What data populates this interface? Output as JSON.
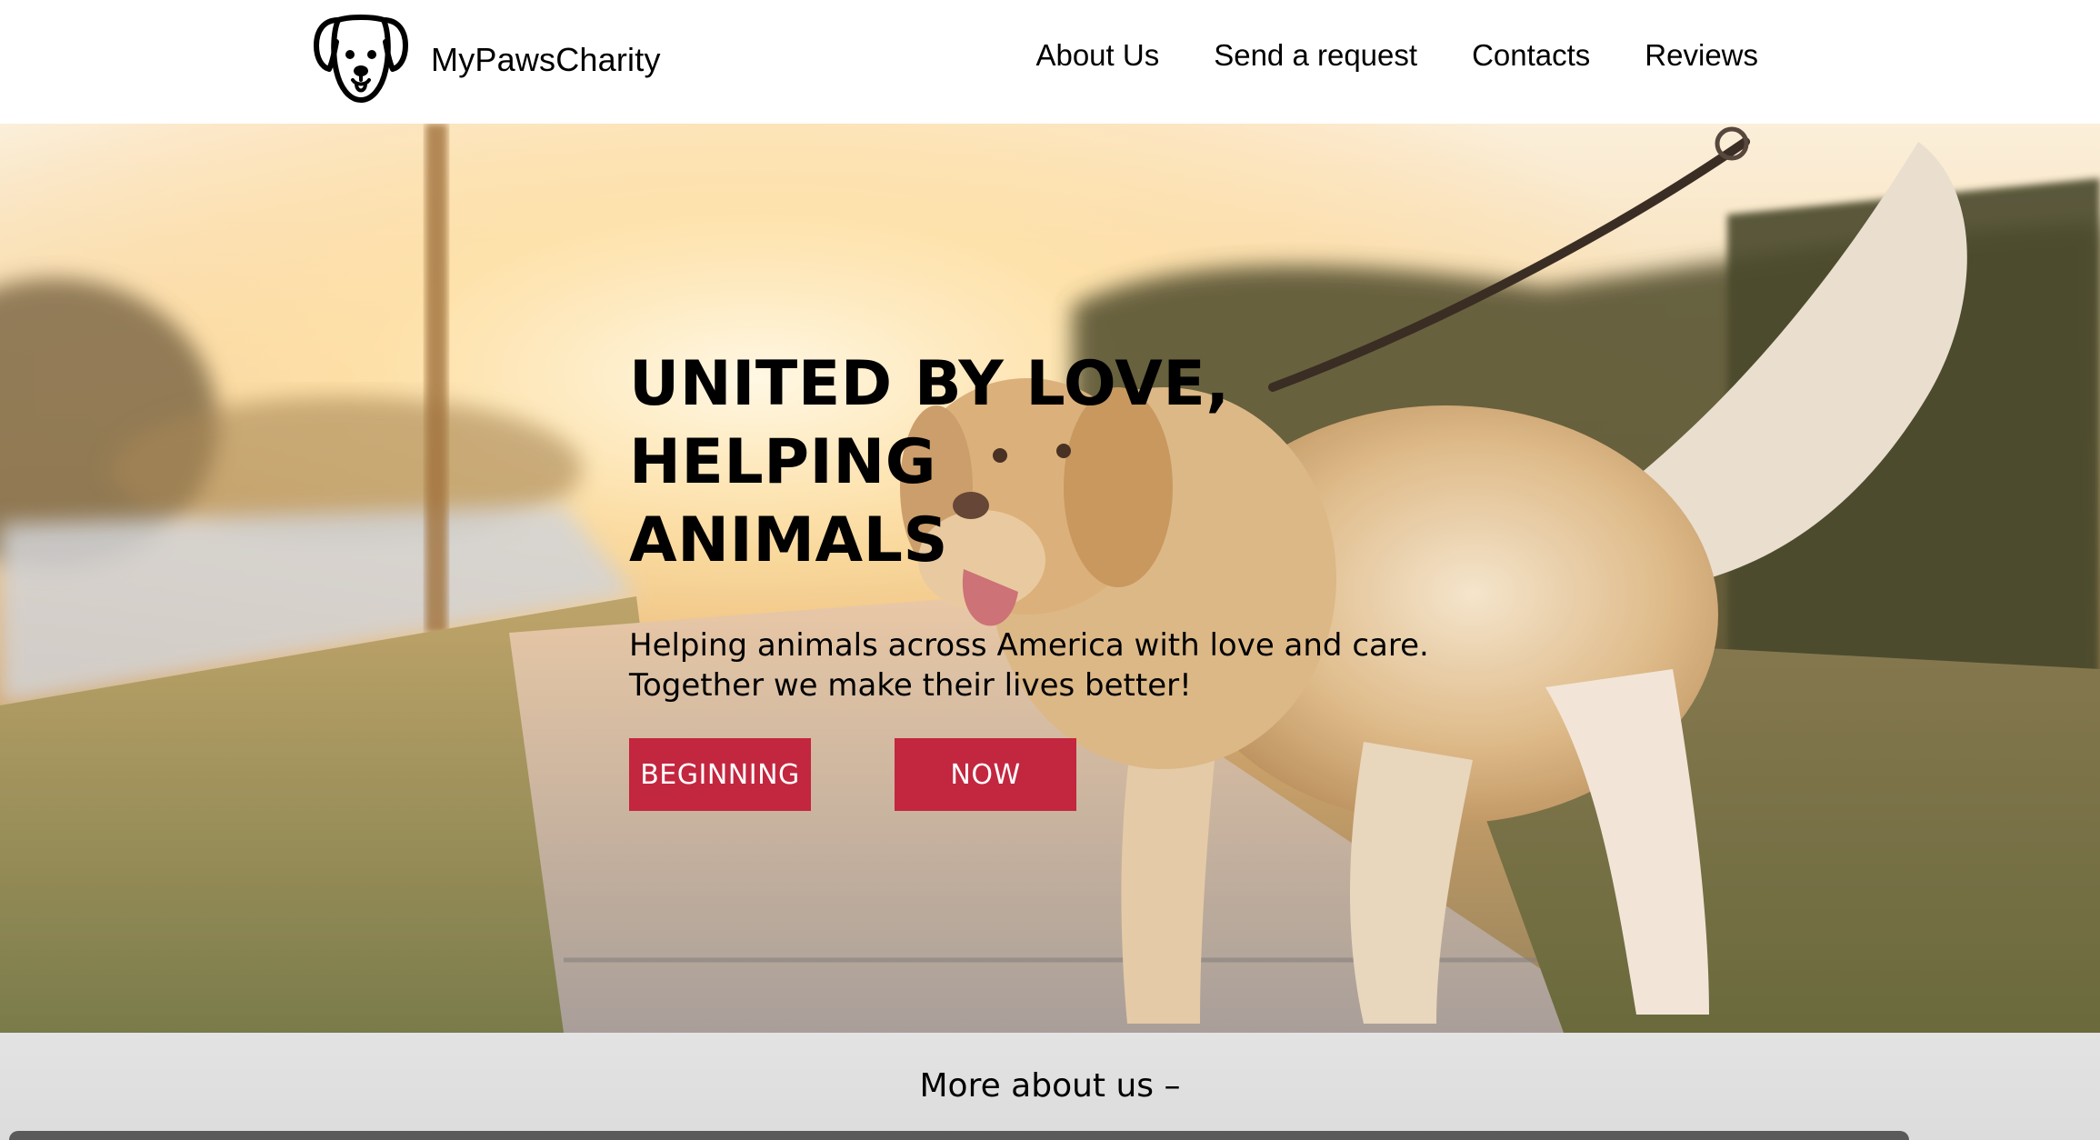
{
  "brand": {
    "name": "MyPawsCharity",
    "logo_icon": "dog-face-icon"
  },
  "nav": {
    "items": [
      {
        "label": "About Us"
      },
      {
        "label": "Send a request"
      },
      {
        "label": "Contacts"
      },
      {
        "label": "Reviews"
      }
    ]
  },
  "hero": {
    "title_lines": [
      "UNITED BY LOVE,",
      "HELPING",
      "ANIMALS"
    ],
    "subtitle_lines": [
      "Helping animals across America with love and care.",
      "Together we make their lives better!"
    ],
    "buttons": {
      "beginning": "BEGINNING",
      "now": "NOW"
    }
  },
  "more": {
    "label": "More about us –"
  },
  "colors": {
    "accent": "#c3263f",
    "header_bg": "#ffffff",
    "band_bg": "#e0e0e0"
  }
}
